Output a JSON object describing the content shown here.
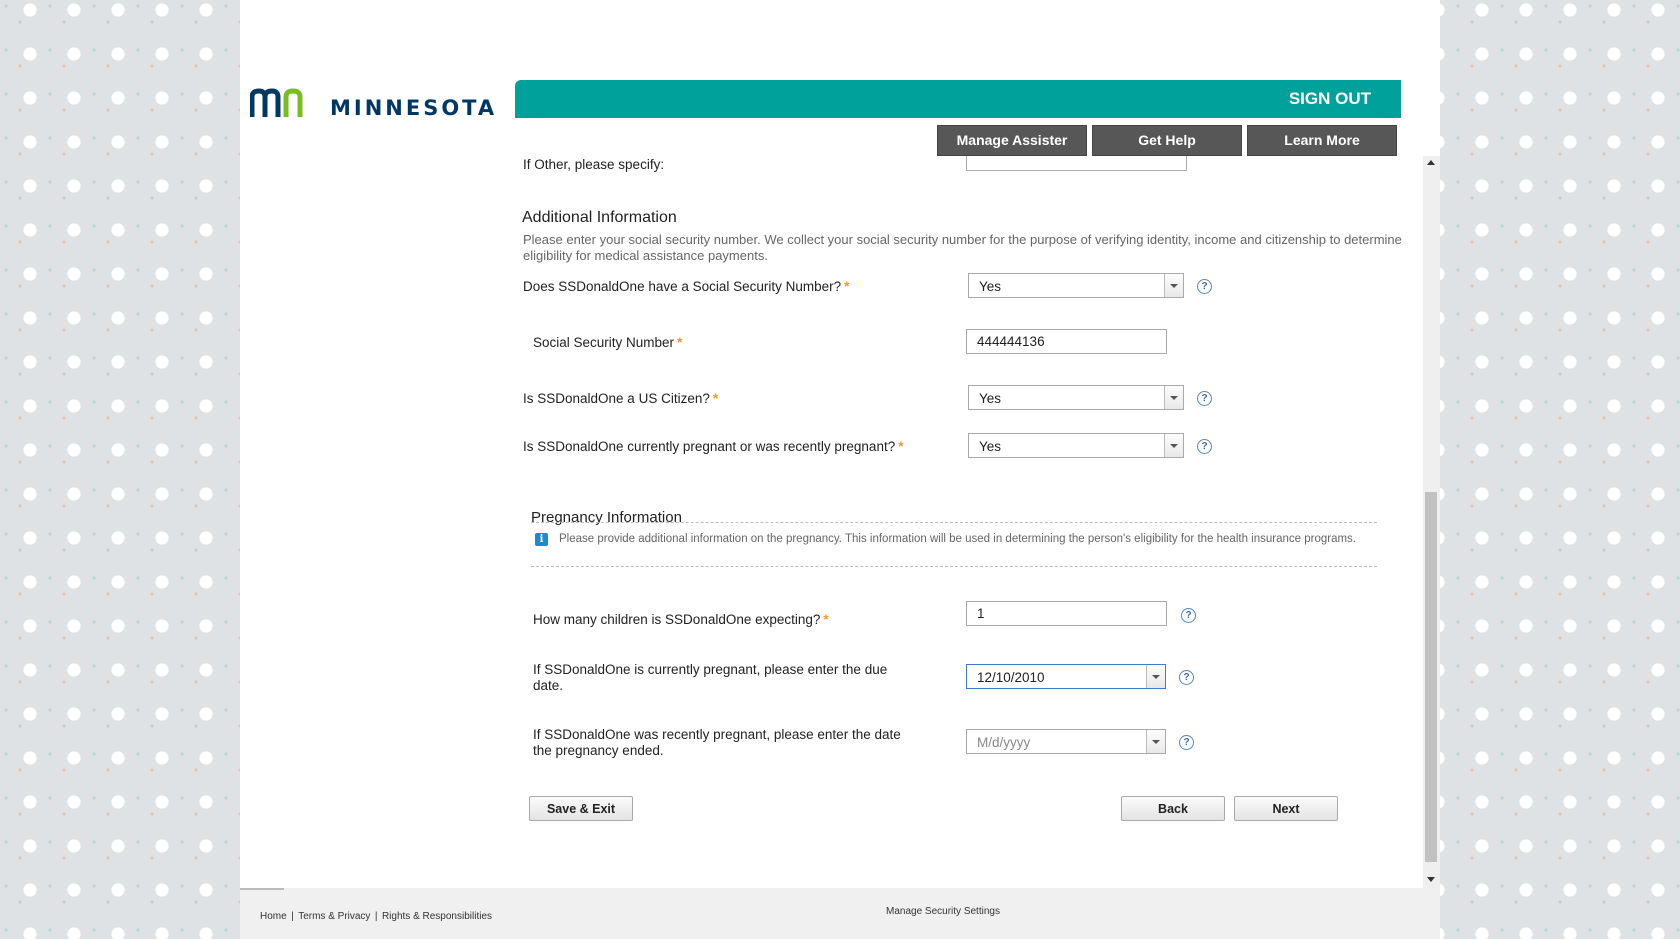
{
  "brand": {
    "logo_text": "MINNESOTA",
    "colors": {
      "teal": "#01a19b",
      "navy": "#003865",
      "green": "#78be20"
    }
  },
  "header": {
    "sign_out": "SIGN OUT",
    "nav": [
      "Manage Assister",
      "Get Help",
      "Learn More"
    ]
  },
  "form": {
    "other_label": "If Other, please specify:",
    "other_value": "",
    "additional": {
      "heading": "Additional Information",
      "description": "Please enter your social security number. We collect your social security number for the purpose of verifying identity, income and citizenship to determine eligibility for medical assistance payments."
    },
    "has_ssn": {
      "label": "Does SSDonaldOne have a Social Security Number?",
      "value": "Yes"
    },
    "ssn": {
      "label": "Social Security Number",
      "value": "444444136"
    },
    "citizen": {
      "label": "Is SSDonaldOne a US Citizen?",
      "value": "Yes"
    },
    "pregnant": {
      "label": "Is SSDonaldOne currently pregnant or was recently pregnant?",
      "value": "Yes"
    },
    "pregnancy": {
      "heading": "Pregnancy Information",
      "info": "Please provide additional information on the pregnancy. This information will be used in determining the person's eligibility for the health insurance programs.",
      "children": {
        "label": "How many children is SSDonaldOne expecting?",
        "value": "1"
      },
      "due_date": {
        "label": "If SSDonaldOne is currently pregnant, please enter the due date.",
        "value": "12/10/2010"
      },
      "end_date": {
        "label": "If SSDonaldOne was recently pregnant, please enter the date the pregnancy ended.",
        "placeholder": "M/d/yyyy"
      }
    },
    "required_mark": "*",
    "help_glyph": "?",
    "info_glyph": "i"
  },
  "buttons": {
    "save_exit": "Save & Exit",
    "back": "Back",
    "next": "Next"
  },
  "footer": {
    "home": "Home",
    "terms": "Terms & Privacy",
    "rights": "Rights & Responsibilities",
    "separator": "|",
    "manage_security": "Manage Security Settings"
  }
}
